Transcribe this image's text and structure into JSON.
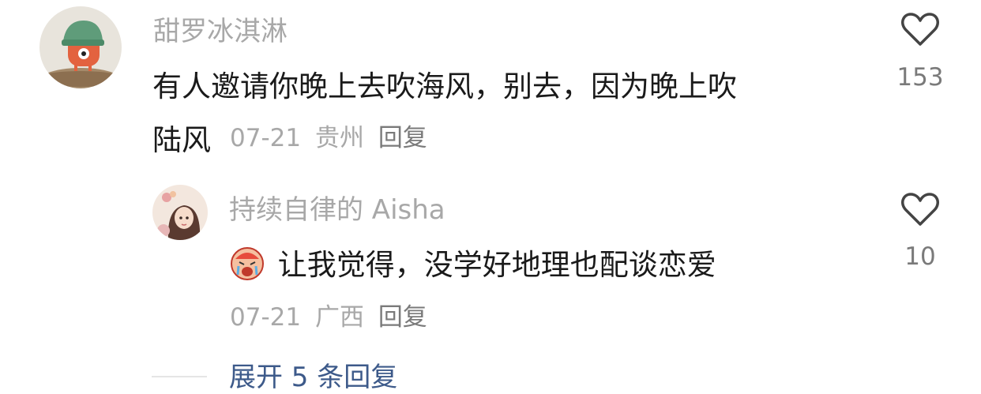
{
  "comments": [
    {
      "username": "甜罗冰淇淋",
      "text_line1": "有人邀请你晚上去吹海风，别去，因为晚上吹",
      "text_line2": "陆风",
      "date": "07-21",
      "location": "贵州",
      "reply_label": "回复",
      "like_count": "153",
      "avatar_icon": "cartoon-avatar-icon"
    },
    {
      "username": "持续自律的 Aisha",
      "emoji_icon": "crying-face-emoji-icon",
      "text": "让我觉得，没学好地理也配谈恋爱",
      "date": "07-21",
      "location": "广西",
      "reply_label": "回复",
      "like_count": "10",
      "avatar_icon": "girl-avatar-icon"
    }
  ],
  "expand_label": "展开 5 条回复",
  "colors": {
    "username": "#a8a8a8",
    "text": "#1a1a1a",
    "meta": "#a8a8a8",
    "link": "#3d5a8a"
  }
}
